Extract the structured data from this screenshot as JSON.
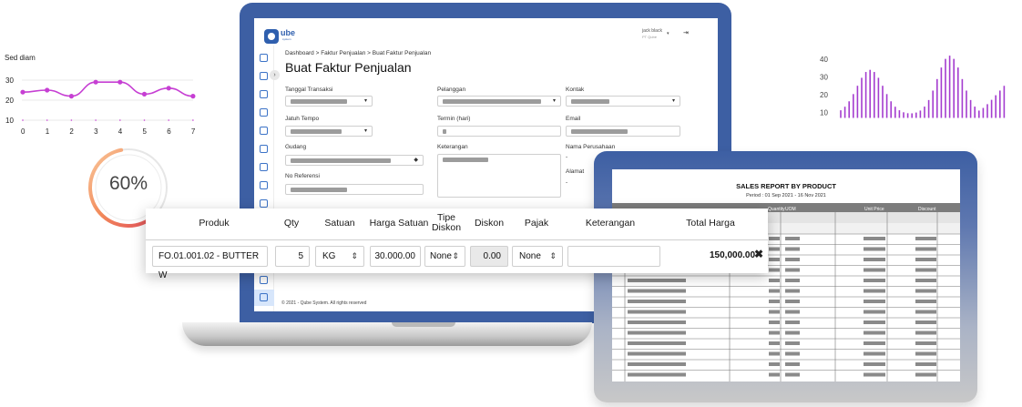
{
  "line_chart": {
    "title": "Sed diam",
    "y_ticks": [
      "30",
      "20",
      "10"
    ],
    "x_ticks": [
      "0",
      "1",
      "2",
      "3",
      "4",
      "5",
      "6",
      "7"
    ],
    "points": [
      24,
      25,
      22,
      29,
      29,
      23,
      26,
      22
    ],
    "color": "#c63fd3"
  },
  "gauge": {
    "label": "60%",
    "value": 0.6
  },
  "bar_chart": {
    "y_ticks": [
      "40",
      "30",
      "20",
      "10"
    ],
    "color": "#a43ccf"
  },
  "app": {
    "logo_text": "ube",
    "logo_sub": "system",
    "user_name": "jack black",
    "user_company": "PT Qube",
    "breadcrumb": "Dashboard > Faktur Penjualan > Buat Faktur Penjualan",
    "page_title": "Buat Faktur Penjualan",
    "labels": {
      "tanggal": "Tanggal Transaksi",
      "pelanggan": "Pelanggan",
      "kontak": "Kontak",
      "jatuh_tempo": "Jatuh Tempo",
      "termin": "Termin (hari)",
      "email": "Email",
      "gudang": "Gudang",
      "keterangan": "Keterangan",
      "nama_perusahaan": "Nama Perusahaan",
      "no_referensi": "No Referensi",
      "alamat": "Alamat"
    },
    "dash": "-",
    "footer": "© 2021 - Qube System. All rights reserved"
  },
  "invoice": {
    "headers": {
      "produk": "Produk",
      "qty": "Qty",
      "satuan": "Satuan",
      "harga": "Harga Satuan",
      "tipe_diskon": "Tipe Diskon",
      "diskon": "Diskon",
      "pajak": "Pajak",
      "keterangan": "Keterangan",
      "total": "Total Harga"
    },
    "row": {
      "produk": "FO.01.001.02 - BUTTER W",
      "qty": "5",
      "satuan": "KG",
      "harga": "30.000.00",
      "tipe_diskon": "None",
      "diskon": "0.00",
      "pajak": "None",
      "keterangan": "",
      "total": "150,000.00"
    }
  },
  "report": {
    "title": "SALES REPORT BY PRODUCT",
    "period": "Period : 01 Sep 2021 - 16 Nov 2021",
    "columns": [
      "Quantity",
      "UOM",
      "Unit Price",
      "Discount"
    ]
  }
}
